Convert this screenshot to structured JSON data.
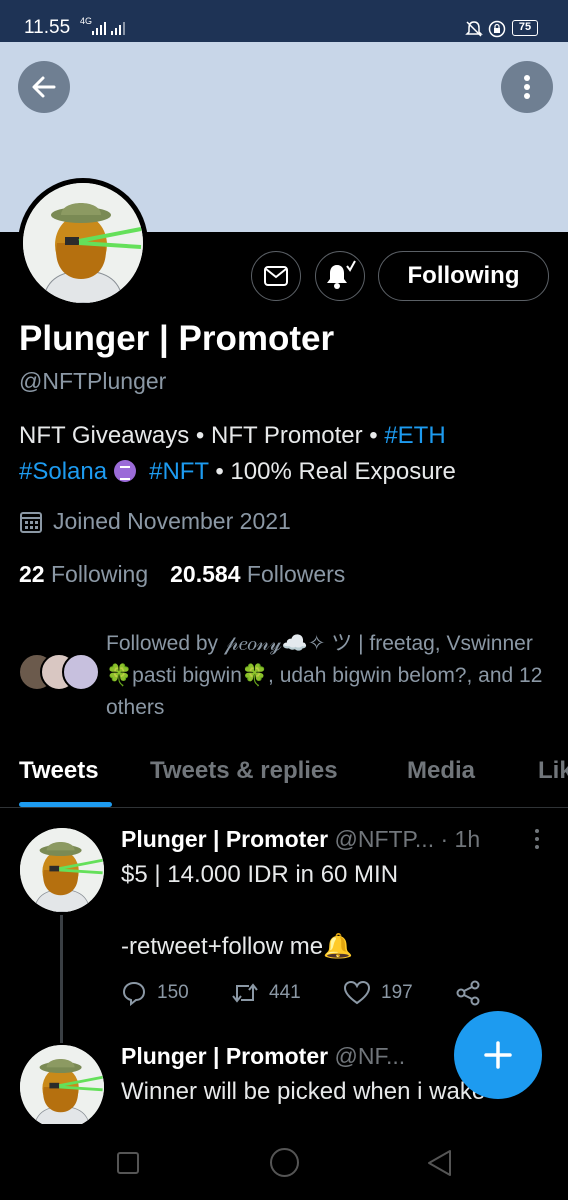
{
  "status_bar": {
    "time": "11.55",
    "network": "4G",
    "battery": "75"
  },
  "profile": {
    "display_name": "Plunger | Promoter",
    "handle": "@NFTPlunger",
    "bio": {
      "part1": "NFT Giveaways • NFT Promoter • ",
      "tag_eth": "#ETH",
      "tag_solana": "#Solana",
      "tag_nft": "#NFT",
      "part2": " • 100% Real Exposure"
    },
    "joined": "Joined November 2021",
    "following_count": "22",
    "following_label": "Following",
    "followers_count": "20.584",
    "followers_label": "Followers",
    "followed_by": "Followed by 𝓅𝑒𝑜𝓃𝓎☁️✧ ツ | freetag, Vswinner 🍀pasti bigwin🍀, udah bigwin belom?, and 12 others"
  },
  "buttons": {
    "following": "Following"
  },
  "tabs": [
    {
      "label": "Tweets"
    },
    {
      "label": "Tweets & replies"
    },
    {
      "label": "Media"
    },
    {
      "label": "Lik"
    }
  ],
  "tweets": [
    {
      "name": "Plunger | Promoter",
      "handle": "@NFTP...",
      "time": "· 1h",
      "line1": "$5 | 14.000 IDR in 60 MIN",
      "line2": "-retweet+follow me🔔",
      "replies": "150",
      "retweets": "441",
      "likes": "197"
    },
    {
      "name": "Plunger | Promoter",
      "handle": "@NF...",
      "line1": "Winner will be picked when i wake"
    }
  ],
  "colors": {
    "accent": "#1d9bf0",
    "banner": "#c8d6e8",
    "status_bar": "#1e3355",
    "background": "#000000"
  },
  "icons": [
    "back-arrow-icon",
    "more-vertical-icon",
    "mail-icon",
    "bell-check-icon",
    "calendar-icon",
    "reply-icon",
    "retweet-icon",
    "like-icon",
    "share-icon",
    "plus-icon"
  ]
}
